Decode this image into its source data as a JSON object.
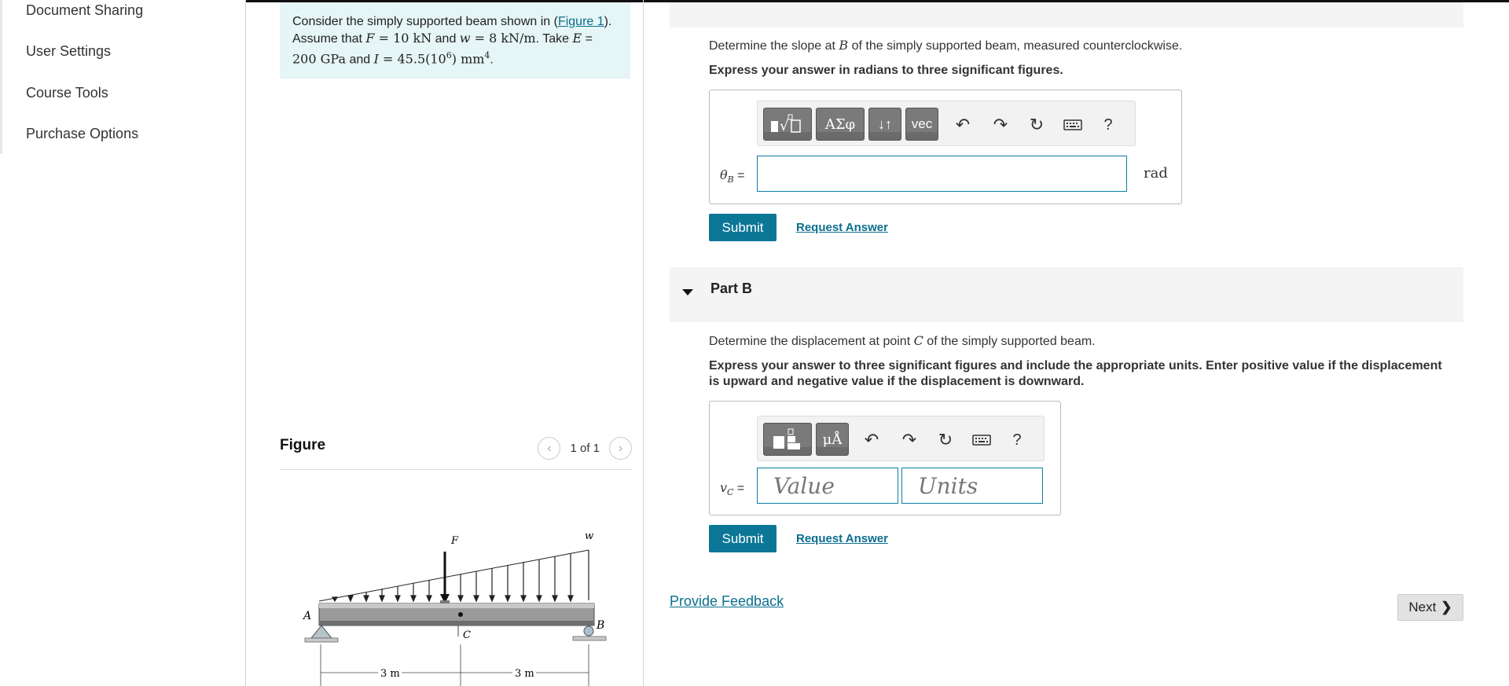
{
  "sidebar": {
    "items": [
      {
        "label": "Document Sharing"
      },
      {
        "label": "User Settings"
      },
      {
        "label": "Course Tools"
      },
      {
        "label": "Purchase Options"
      }
    ]
  },
  "problem": {
    "line1_prefix": "Consider the simply supported beam shown in (",
    "figure_link": "Figure 1",
    "line1_suffix": ").",
    "line2_a": "Assume that ",
    "F_sym": "F",
    "F_val": " = 10 kN",
    "and_w": " and ",
    "w_sym": "w",
    "w_val": " = 8 kN/m",
    "take": ". Take ",
    "E_sym": "E",
    "E_eq": " =",
    "E_val": "200 GPa",
    "and_I": " and ",
    "I_sym": "I",
    "I_val": " = 45.5(10",
    "I_exp": "6",
    "I_unit": ") mm",
    "I_unit_exp": "4",
    "end": "."
  },
  "figure": {
    "title": "Figure",
    "pager": "1 of 1",
    "labels": {
      "A": "A",
      "B": "B",
      "C": "C",
      "F": "F",
      "w": "w",
      "dim1": "3 m",
      "dim2": "3 m"
    }
  },
  "partA": {
    "question_prefix": "Determine the slope at ",
    "question_sym": "B",
    "question_suffix": " of the simply supported beam, measured counterclockwise.",
    "instruction": "Express your answer in radians to three significant figures.",
    "toolbar_buttons": [
      "ΑΣφ",
      "↓↑",
      "vec"
    ],
    "help": "?",
    "answer_label_sym": "θ",
    "answer_label_sub": "B",
    "answer_label_eq": " =",
    "input_value": "",
    "unit": "rad",
    "submit": "Submit",
    "request": "Request Answer"
  },
  "partB": {
    "title": "Part B",
    "question_prefix": "Determine the displacement at point ",
    "question_sym": "C",
    "question_suffix": " of the simply supported beam.",
    "instruction_line1": "Express your answer to three significant figures and include the appropriate units. Enter positive value if the displacement",
    "instruction_line2": "is upward and negative value if the displacement is downward.",
    "toolbar_buttons": [
      "μÅ"
    ],
    "help": "?",
    "answer_label_sym": "v",
    "answer_label_sub": "C",
    "answer_label_eq": " =",
    "value_placeholder": "Value",
    "units_placeholder": "Units",
    "submit": "Submit",
    "request": "Request Answer"
  },
  "footer": {
    "feedback": "Provide Feedback",
    "next": "Next"
  }
}
